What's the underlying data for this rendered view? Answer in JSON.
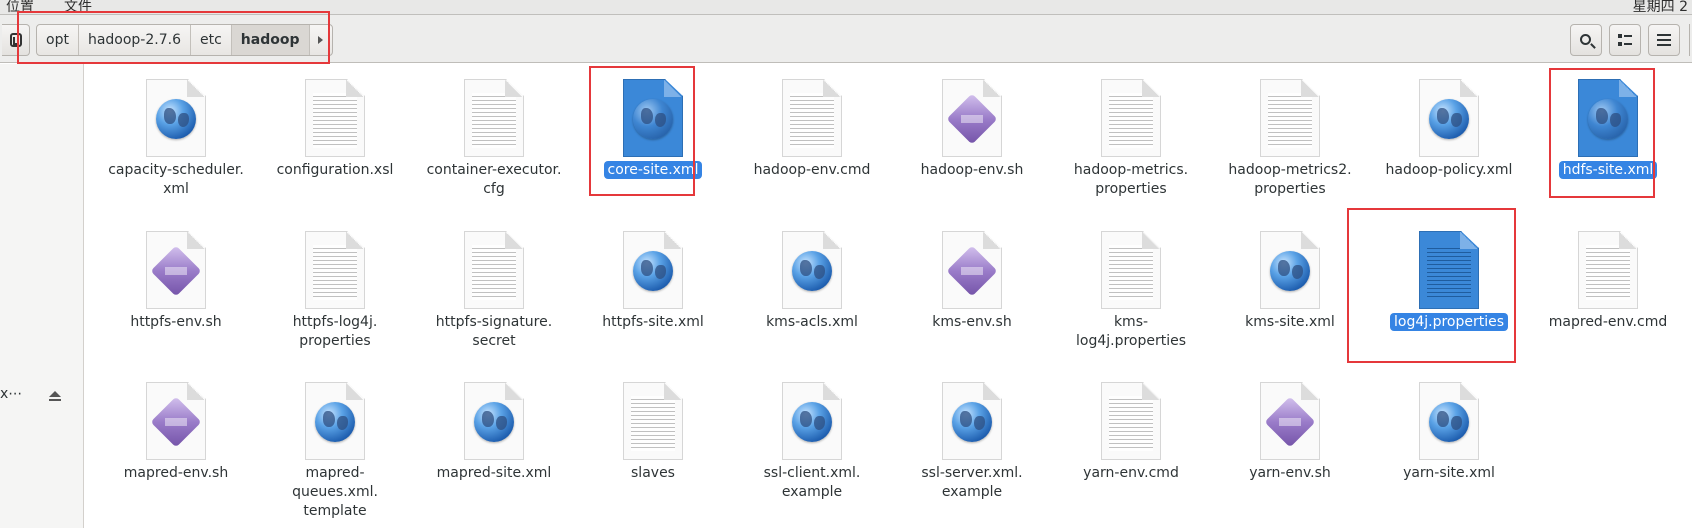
{
  "topbar": {
    "menu_places": "位置",
    "menu_files": "文件",
    "clock": "星期四 2"
  },
  "pathbar": {
    "crumbs": [
      "opt",
      "hadoop-2.7.6",
      "etc",
      "hadoop"
    ],
    "active_index": 3
  },
  "header_buttons": {
    "search": "search-icon",
    "view": "list-view-icon",
    "menu": "hamburger-menu-icon"
  },
  "sidebar": {
    "truncated_item": "x⋯"
  },
  "files": [
    {
      "name": "capacity-scheduler.\nxml",
      "type": "globe"
    },
    {
      "name": "configuration.xsl",
      "type": "text"
    },
    {
      "name": "container-executor.\ncfg",
      "type": "text"
    },
    {
      "name": "core-site.xml",
      "type": "globe",
      "selected": true
    },
    {
      "name": "hadoop-env.cmd",
      "type": "text"
    },
    {
      "name": "hadoop-env.sh",
      "type": "script"
    },
    {
      "name": "hadoop-metrics.\nproperties",
      "type": "text"
    },
    {
      "name": "hadoop-metrics2.\nproperties",
      "type": "text"
    },
    {
      "name": "hadoop-policy.xml",
      "type": "globe"
    },
    {
      "name": "hdfs-site.xml",
      "type": "globe",
      "selected": true
    },
    {
      "name": "httpfs-env.sh",
      "type": "script"
    },
    {
      "name": "httpfs-log4j.\nproperties",
      "type": "text"
    },
    {
      "name": "httpfs-signature.\nsecret",
      "type": "text"
    },
    {
      "name": "httpfs-site.xml",
      "type": "globe"
    },
    {
      "name": "kms-acls.xml",
      "type": "globe"
    },
    {
      "name": "kms-env.sh",
      "type": "script"
    },
    {
      "name": "kms-log4j.properties",
      "type": "text"
    },
    {
      "name": "kms-site.xml",
      "type": "globe"
    },
    {
      "name": "log4j.properties",
      "type": "text",
      "selected": true
    },
    {
      "name": "mapred-env.cmd",
      "type": "text"
    },
    {
      "name": "mapred-env.sh",
      "type": "script"
    },
    {
      "name": "mapred-queues.xml.\ntemplate",
      "type": "globe"
    },
    {
      "name": "mapred-site.xml",
      "type": "globe"
    },
    {
      "name": "slaves",
      "type": "text"
    },
    {
      "name": "ssl-client.xml.\nexample",
      "type": "globe"
    },
    {
      "name": "ssl-server.xml.\nexample",
      "type": "globe"
    },
    {
      "name": "yarn-env.cmd",
      "type": "text"
    },
    {
      "name": "yarn-env.sh",
      "type": "script"
    },
    {
      "name": "yarn-site.xml",
      "type": "globe"
    }
  ],
  "colors": {
    "selection": "#3584e4",
    "annotation_box": "#e5383b"
  }
}
